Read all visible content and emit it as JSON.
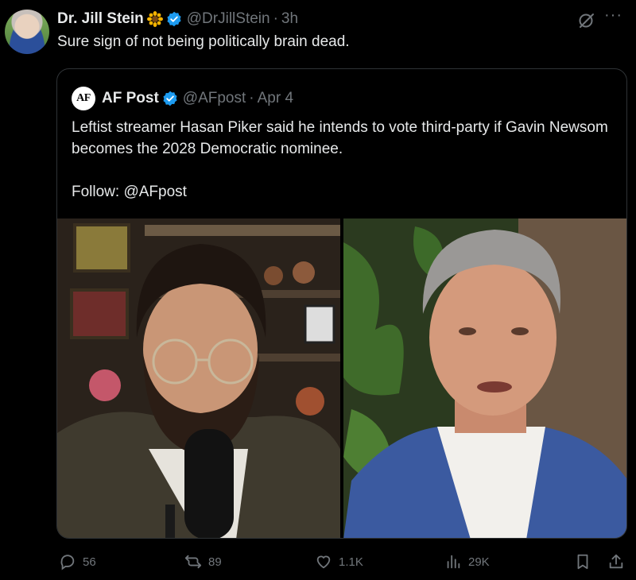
{
  "tweet": {
    "author_name": "Dr. Jill Stein",
    "handle": "@DrJillStein",
    "separator": "·",
    "time": "3h",
    "text": "Sure sign of not being politically brain dead."
  },
  "quote": {
    "logo_text": "AF",
    "author_name": "AF Post",
    "handle": "@AFpost",
    "separator": "·",
    "date": "Apr 4",
    "text_line1": "Leftist streamer Hasan Piker said he intends to vote third-party if Gavin Newsom becomes the 2028 Democratic nominee.",
    "text_line2": "Follow: @AFpost"
  },
  "actions": {
    "replies": "56",
    "reposts": "89",
    "likes": "1.1K",
    "views": "29K"
  },
  "icons": {
    "verified": "verified-badge-icon",
    "sunflower": "sunflower-icon",
    "grok": "grok-icon",
    "more": "more-icon"
  },
  "colors": {
    "background": "#000000",
    "text": "#e7e9ea",
    "muted": "#71767b",
    "verified": "#1d9bf0",
    "border": "#2f3336"
  }
}
